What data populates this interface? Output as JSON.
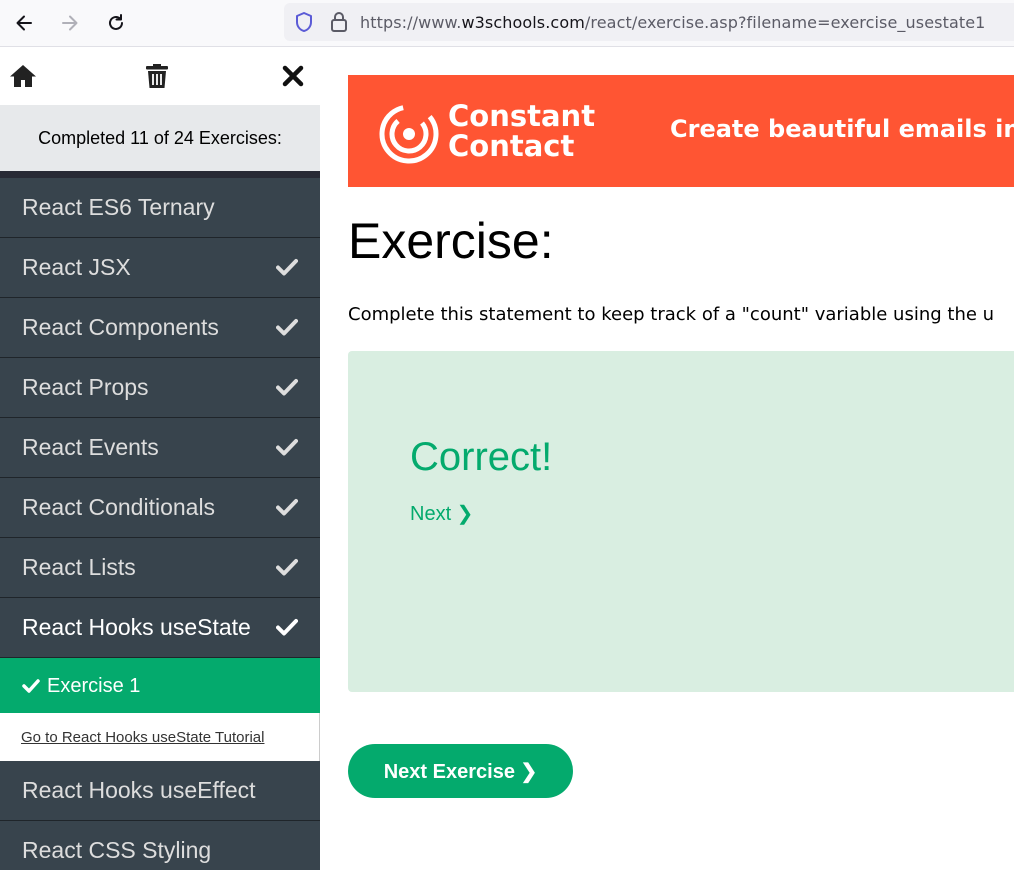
{
  "browser": {
    "url_prefix": "https://www.",
    "url_host": "w3schools.com",
    "url_path": "/react/exercise.asp?filename=exercise_usestate1"
  },
  "sidebar": {
    "progress_text": "Completed 11 of 24 Exercises:",
    "items": [
      {
        "label": "React ES6 Ternary",
        "completed": false
      },
      {
        "label": "React JSX",
        "completed": true
      },
      {
        "label": "React Components",
        "completed": true
      },
      {
        "label": "React Props",
        "completed": true
      },
      {
        "label": "React Events",
        "completed": true
      },
      {
        "label": "React Conditionals",
        "completed": true
      },
      {
        "label": "React Lists",
        "completed": true
      },
      {
        "label": "React Hooks useState",
        "completed": true
      },
      {
        "label": "React Hooks useEffect",
        "completed": false
      },
      {
        "label": "React CSS Styling",
        "completed": false
      }
    ],
    "current_exercise": "Exercise 1",
    "tutorial_link": "Go to React Hooks useState Tutorial"
  },
  "ad": {
    "brand_line1": "Constant",
    "brand_line2": "Contact",
    "tagline": "Create beautiful emails in m"
  },
  "main": {
    "title": "Exercise:",
    "instruction": "Complete this statement to keep track of a \"count\" variable using the u",
    "result_text": "Correct!",
    "next_link": "Next ❯",
    "next_exercise_button": "Next Exercise ❯"
  },
  "colors": {
    "accent": "#04AA6D",
    "sidebar_bg": "#38444d",
    "result_bg": "#D9EEE1",
    "ad_bg": "#ff5533"
  }
}
